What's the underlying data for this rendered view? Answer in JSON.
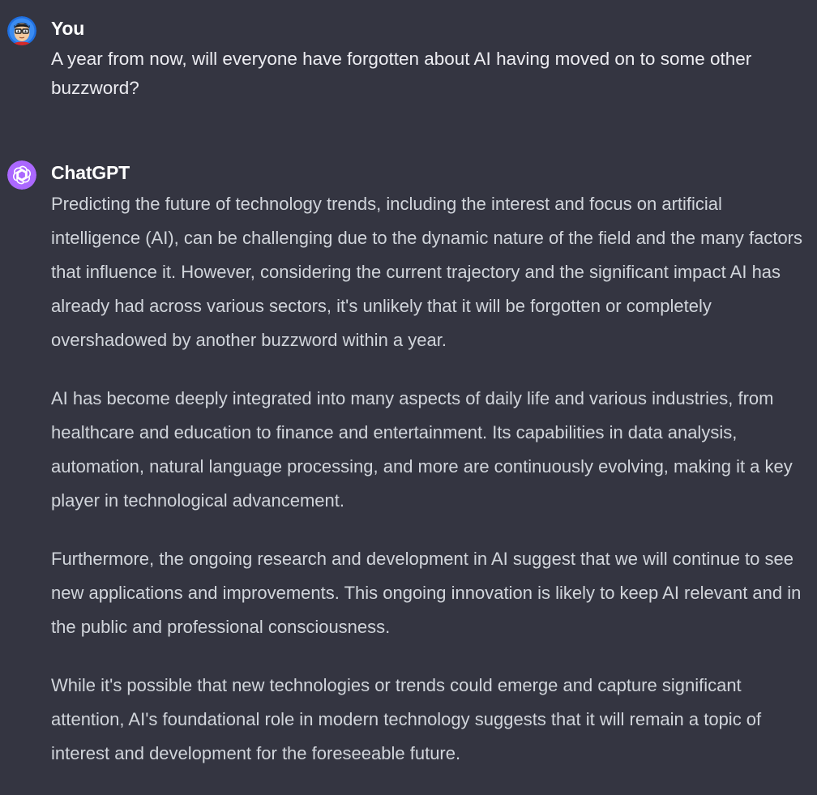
{
  "conversation": {
    "user_message": {
      "author": "You",
      "avatar_icon": "user-avatar-icon",
      "text": "A year from now, will everyone have forgotten about AI having moved on to some other buzzword?"
    },
    "assistant_message": {
      "author": "ChatGPT",
      "avatar_icon": "openai-logo-icon",
      "avatar_color": "#ab68ff",
      "paragraphs": [
        "Predicting the future of technology trends, including the interest and focus on artificial intelligence (AI), can be challenging due to the dynamic nature of the field and the many factors that influence it. However, considering the current trajectory and the significant impact AI has already had across various sectors, it's unlikely that it will be forgotten or completely overshadowed by another buzzword within a year.",
        "AI has become deeply integrated into many aspects of daily life and various industries, from healthcare and education to finance and entertainment. Its capabilities in data analysis, automation, natural language processing, and more are continuously evolving, making it a key player in technological advancement.",
        "Furthermore, the ongoing research and development in AI suggest that we will continue to see new applications and improvements. This ongoing innovation is likely to keep AI relevant and in the public and professional consciousness.",
        "While it's possible that new technologies or trends could emerge and capture significant attention, AI's foundational role in modern technology suggests that it will remain a topic of interest and development for the foreseeable future."
      ]
    },
    "colors": {
      "background": "#343541",
      "author_text": "#ffffff",
      "body_text": "#d1d5db"
    }
  }
}
